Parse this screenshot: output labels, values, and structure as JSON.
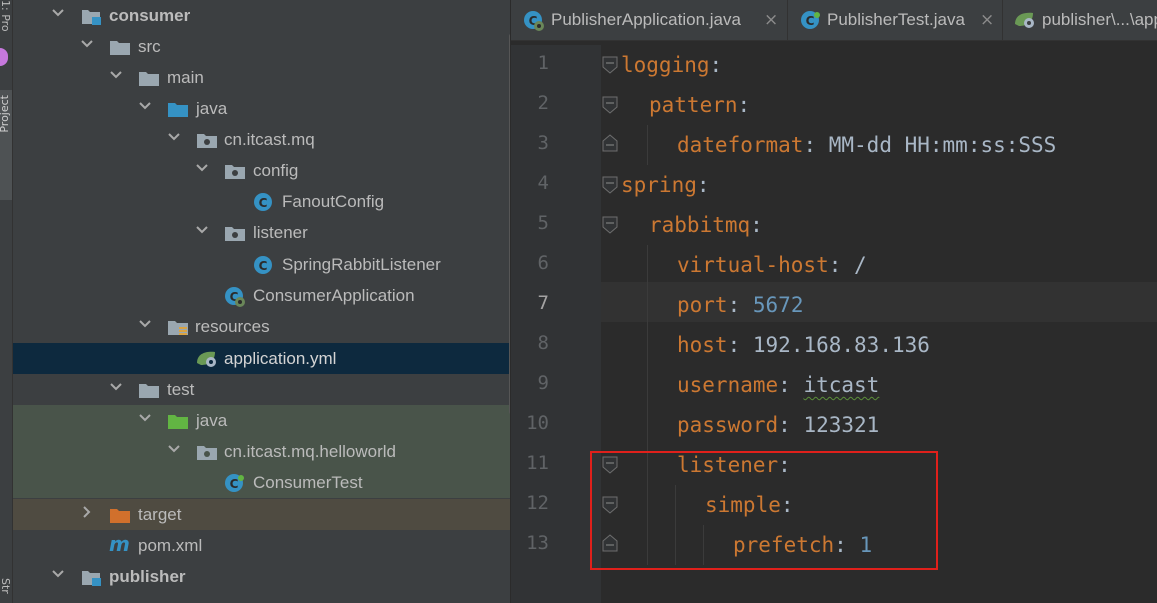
{
  "sidebar": {
    "strip_label": "Project",
    "strip_top_label": "1: Pro",
    "strip_bottom_label": "Str"
  },
  "tree": {
    "rows": [
      {
        "label": "consumer",
        "icon": "module-folder-icon",
        "bold": true
      },
      {
        "label": "src",
        "icon": "folder-icon"
      },
      {
        "label": "main",
        "icon": "folder-icon"
      },
      {
        "label": "java",
        "icon": "source-folder-icon"
      },
      {
        "label": "cn.itcast.mq",
        "icon": "package-icon"
      },
      {
        "label": "config",
        "icon": "package-icon"
      },
      {
        "label": "FanoutConfig",
        "icon": "class-icon"
      },
      {
        "label": "listener",
        "icon": "package-icon"
      },
      {
        "label": "SpringRabbitListener",
        "icon": "class-icon"
      },
      {
        "label": "ConsumerApplication",
        "icon": "spring-boot-class-icon"
      },
      {
        "label": "resources",
        "icon": "resources-folder-icon"
      },
      {
        "label": "application.yml",
        "icon": "spring-yml-icon"
      },
      {
        "label": "test",
        "icon": "folder-icon"
      },
      {
        "label": "java",
        "icon": "test-source-folder-icon"
      },
      {
        "label": "cn.itcast.mq.helloworld",
        "icon": "package-icon"
      },
      {
        "label": "ConsumerTest",
        "icon": "class-icon"
      },
      {
        "label": "target",
        "icon": "excluded-folder-icon"
      },
      {
        "label": "pom.xml",
        "icon": "maven-icon"
      },
      {
        "label": "publisher",
        "icon": "module-folder-icon",
        "bold": true
      }
    ]
  },
  "tabs": [
    {
      "label": "PublisherApplication.java",
      "icon": "spring-boot-class-icon",
      "close": "×"
    },
    {
      "label": "PublisherTest.java",
      "icon": "class-icon",
      "close": "×"
    },
    {
      "label": "publisher\\...\\application.yml",
      "icon": "spring-yml-icon"
    }
  ],
  "editor": {
    "current_line": "7",
    "lines": [
      {
        "n": "1",
        "key": "logging",
        "sep": ":",
        "value": ""
      },
      {
        "n": "2",
        "key": "pattern",
        "sep": ":",
        "value": ""
      },
      {
        "n": "3",
        "key": "dateformat",
        "sep": ":",
        "value": "MM-dd HH:mm:ss:SSS"
      },
      {
        "n": "4",
        "key": "spring",
        "sep": ":",
        "value": ""
      },
      {
        "n": "5",
        "key": "rabbitmq",
        "sep": ":",
        "value": ""
      },
      {
        "n": "6",
        "key": "virtual-host",
        "sep": ":",
        "value": "/"
      },
      {
        "n": "7",
        "key": "port",
        "sep": ":",
        "value": "5672"
      },
      {
        "n": "8",
        "key": "host",
        "sep": ":",
        "value": "192.168.83.136"
      },
      {
        "n": "9",
        "key": "username",
        "sep": ":",
        "value": "itcast"
      },
      {
        "n": "10",
        "key": "password",
        "sep": ":",
        "value": "123321"
      },
      {
        "n": "11",
        "key": "listener",
        "sep": ":",
        "value": ""
      },
      {
        "n": "12",
        "key": "simple",
        "sep": ":",
        "value": ""
      },
      {
        "n": "13",
        "key": "prefetch",
        "sep": ":",
        "value": "1"
      }
    ]
  },
  "colors": {
    "highlight": "#e0201b",
    "yaml_key": "#cc7832",
    "number": "#6897bb",
    "selection": "#0d293e"
  }
}
